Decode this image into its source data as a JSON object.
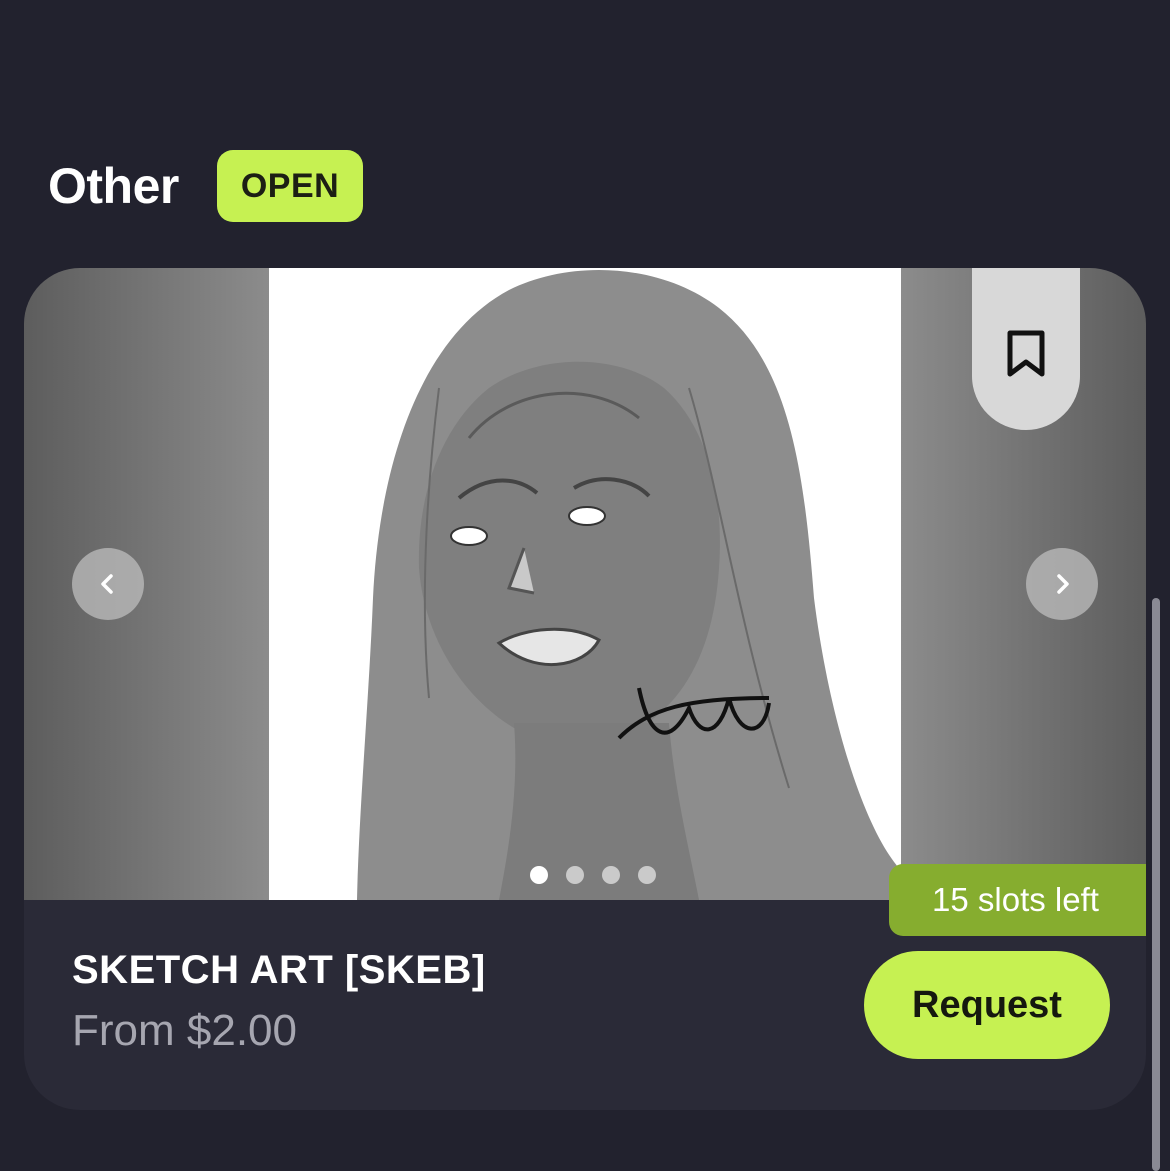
{
  "section": {
    "title": "Other",
    "status": "OPEN"
  },
  "card": {
    "product_title": "SKETCH ART [SKEB]",
    "price": "From $2.00",
    "slots": "15 slots left",
    "request_label": "Request",
    "gallery": {
      "image_count": 4,
      "active_index": 0
    }
  },
  "icons": {
    "bookmark": "bookmark-icon",
    "prev": "chevron-left-icon",
    "next": "chevron-right-icon"
  },
  "colors": {
    "background": "#22222e",
    "card": "#2a2a37",
    "accent": "#c6f152",
    "slots_badge": "#86ad2f"
  }
}
